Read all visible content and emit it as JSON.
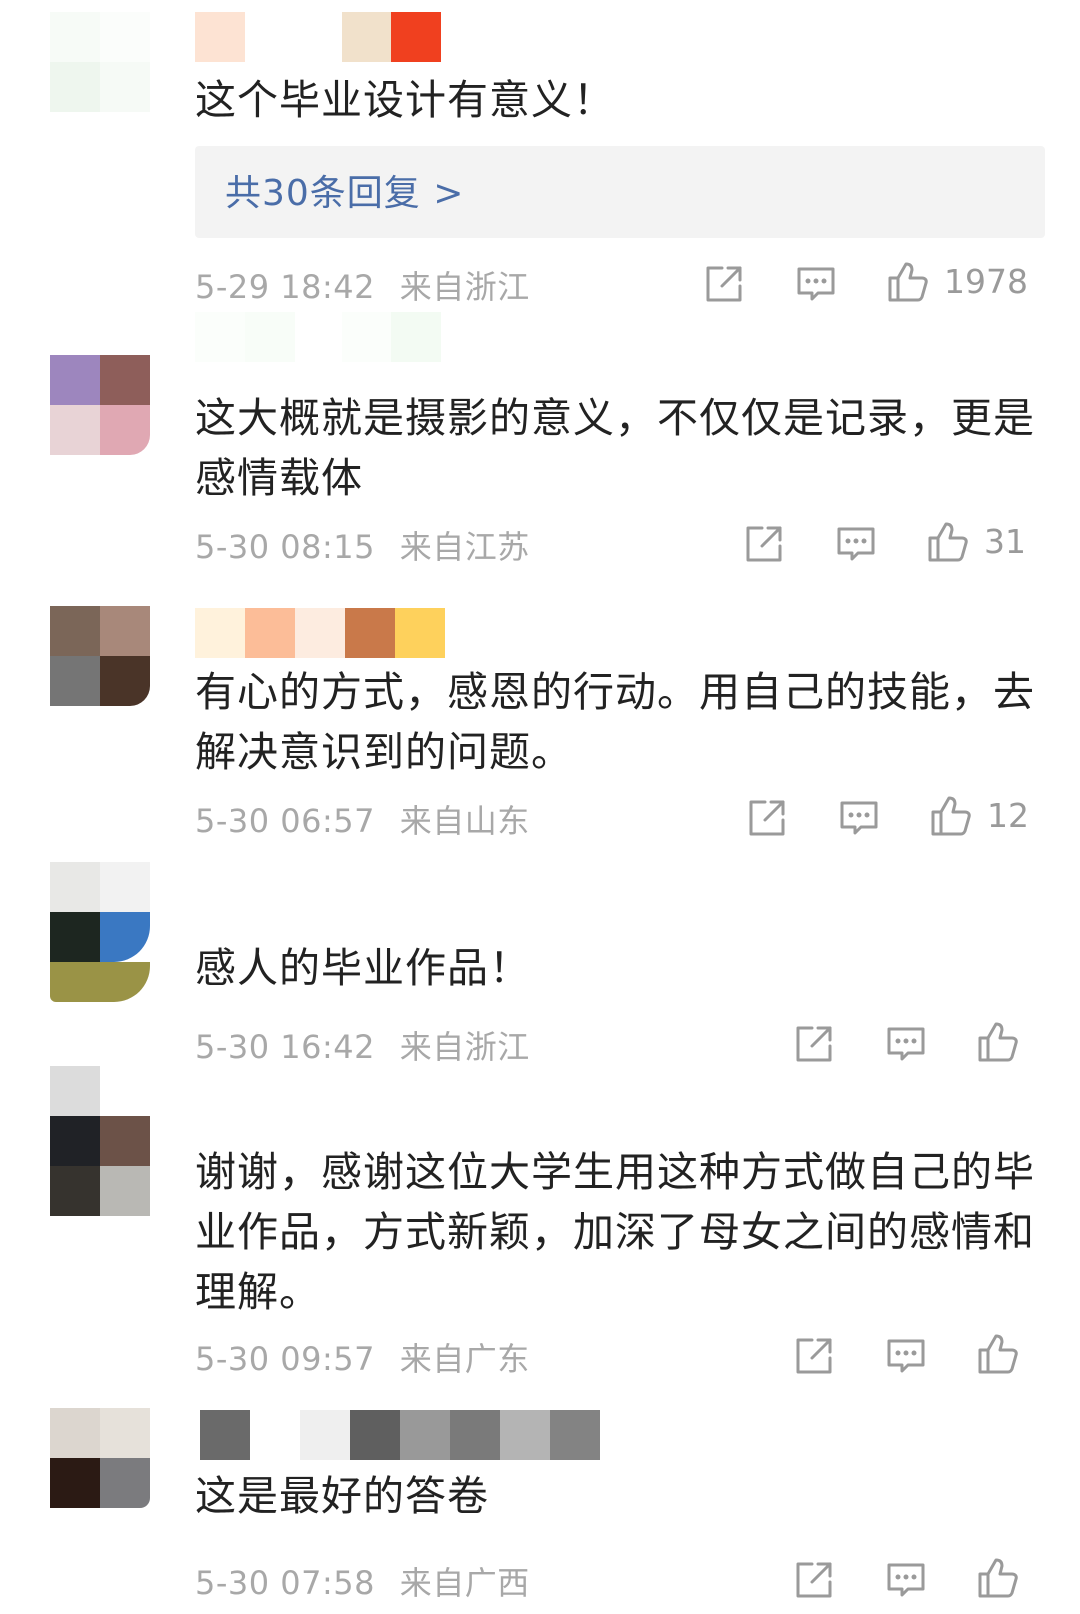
{
  "colors": {
    "reply_link": "#4a6da8",
    "meta_gray": "#a8a8a8",
    "icon_gray": "#9a9a9a",
    "reply_bg": "#f3f3f3"
  },
  "icons": {
    "share": "share-icon",
    "comment": "comment-icon",
    "like": "thumbs-up-icon"
  },
  "comments": [
    {
      "text": "这个毕业设计有意义！",
      "reply_link": "共30条回复 >",
      "time": "5-29 18:42",
      "location": "来自浙江",
      "likes": "1978"
    },
    {
      "text": "这大概就是摄影的意义，不仅仅是记录，更是感情载体",
      "time": "5-30 08:15",
      "location": "来自江苏",
      "likes": "31"
    },
    {
      "text": "有心的方式，感恩的行动。用自己的技能，去解决意识到的问题。",
      "time": "5-30 06:57",
      "location": "来自山东",
      "likes": "12"
    },
    {
      "text": "感人的毕业作品！",
      "time": "5-30 16:42",
      "location": "来自浙江",
      "likes": ""
    },
    {
      "text": "谢谢，感谢这位大学生用这种方式做自己的毕业作品，方式新颖，加深了母女之间的感情和理解。",
      "time": "5-30 09:57",
      "location": "来自广东",
      "likes": ""
    },
    {
      "text": "这是最好的答卷",
      "time": "5-30 07:58",
      "location": "来自广西",
      "likes": ""
    }
  ]
}
